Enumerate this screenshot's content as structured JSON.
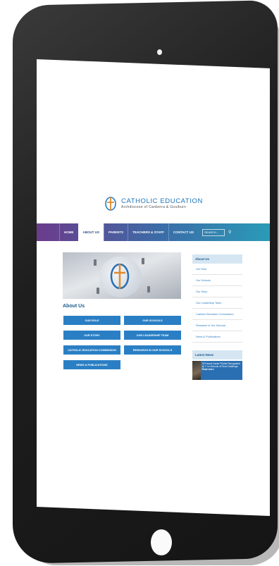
{
  "site": {
    "logo": {
      "title": "CATHOLIC EDUCATION",
      "subtitle": "Archdiocese of Canberra & Goulburn"
    },
    "nav": {
      "items": [
        {
          "label": "HOME",
          "active": false
        },
        {
          "label": "ABOUT US",
          "active": true
        },
        {
          "label": "PARENTS",
          "active": false
        },
        {
          "label": "TEACHERS & STAFF",
          "active": false
        },
        {
          "label": "CONTACT US",
          "active": false
        }
      ],
      "search_placeholder": "SEARCH..."
    },
    "main": {
      "section_title": "About Us",
      "tiles": [
        "OUR ROLE",
        "OUR SCHOOLS",
        "OUR STORY",
        "OUR LEADERSHIP TEAM",
        "CATHOLIC EDUCATION COMMISSION",
        "RESEARCH IN OUR SCHOOLS",
        "NEWS & PUBLICATIONS"
      ]
    },
    "sidebar": {
      "heading": "About Us",
      "items": [
        "Our Role",
        "Our Schools",
        "Our Story",
        "Our Leadership Team",
        "Catholic Education Commission",
        "Research in Our Schools",
        "News & Publications"
      ],
      "news_heading": "Latest News",
      "news": {
        "text": "St Francis Xavier Flinthe Recognised @ Y I.e Schools of Final Challenge",
        "more": "Read more"
      }
    }
  },
  "colors": {
    "brand_blue": "#2a7fc4",
    "nav_start": "#6c3b8c",
    "nav_end": "#2a9bb7"
  }
}
